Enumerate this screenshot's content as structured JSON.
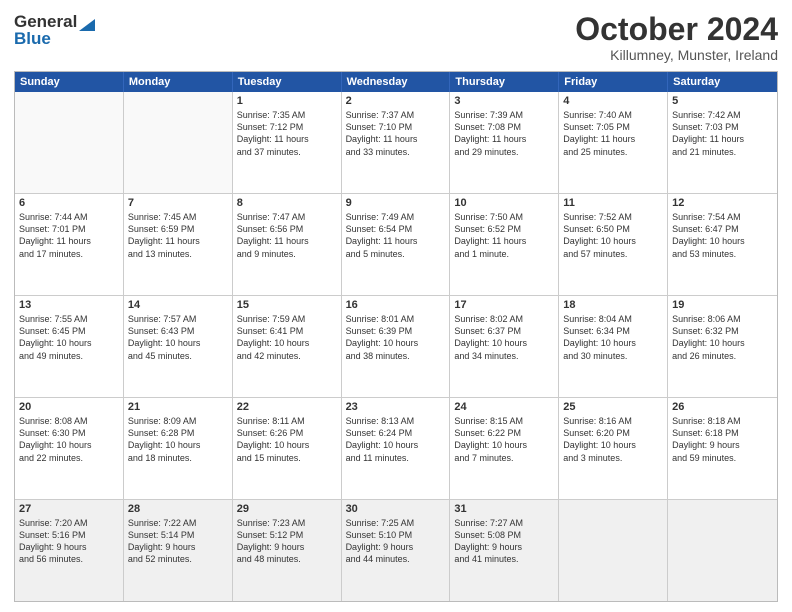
{
  "logo": {
    "line1": "General",
    "line2": "Blue"
  },
  "title": "October 2024",
  "location": "Killumney, Munster, Ireland",
  "days": [
    "Sunday",
    "Monday",
    "Tuesday",
    "Wednesday",
    "Thursday",
    "Friday",
    "Saturday"
  ],
  "weeks": [
    [
      {
        "day": "",
        "text": ""
      },
      {
        "day": "",
        "text": ""
      },
      {
        "day": "1",
        "text": "Sunrise: 7:35 AM\nSunset: 7:12 PM\nDaylight: 11 hours\nand 37 minutes."
      },
      {
        "day": "2",
        "text": "Sunrise: 7:37 AM\nSunset: 7:10 PM\nDaylight: 11 hours\nand 33 minutes."
      },
      {
        "day": "3",
        "text": "Sunrise: 7:39 AM\nSunset: 7:08 PM\nDaylight: 11 hours\nand 29 minutes."
      },
      {
        "day": "4",
        "text": "Sunrise: 7:40 AM\nSunset: 7:05 PM\nDaylight: 11 hours\nand 25 minutes."
      },
      {
        "day": "5",
        "text": "Sunrise: 7:42 AM\nSunset: 7:03 PM\nDaylight: 11 hours\nand 21 minutes."
      }
    ],
    [
      {
        "day": "6",
        "text": "Sunrise: 7:44 AM\nSunset: 7:01 PM\nDaylight: 11 hours\nand 17 minutes."
      },
      {
        "day": "7",
        "text": "Sunrise: 7:45 AM\nSunset: 6:59 PM\nDaylight: 11 hours\nand 13 minutes."
      },
      {
        "day": "8",
        "text": "Sunrise: 7:47 AM\nSunset: 6:56 PM\nDaylight: 11 hours\nand 9 minutes."
      },
      {
        "day": "9",
        "text": "Sunrise: 7:49 AM\nSunset: 6:54 PM\nDaylight: 11 hours\nand 5 minutes."
      },
      {
        "day": "10",
        "text": "Sunrise: 7:50 AM\nSunset: 6:52 PM\nDaylight: 11 hours\nand 1 minute."
      },
      {
        "day": "11",
        "text": "Sunrise: 7:52 AM\nSunset: 6:50 PM\nDaylight: 10 hours\nand 57 minutes."
      },
      {
        "day": "12",
        "text": "Sunrise: 7:54 AM\nSunset: 6:47 PM\nDaylight: 10 hours\nand 53 minutes."
      }
    ],
    [
      {
        "day": "13",
        "text": "Sunrise: 7:55 AM\nSunset: 6:45 PM\nDaylight: 10 hours\nand 49 minutes."
      },
      {
        "day": "14",
        "text": "Sunrise: 7:57 AM\nSunset: 6:43 PM\nDaylight: 10 hours\nand 45 minutes."
      },
      {
        "day": "15",
        "text": "Sunrise: 7:59 AM\nSunset: 6:41 PM\nDaylight: 10 hours\nand 42 minutes."
      },
      {
        "day": "16",
        "text": "Sunrise: 8:01 AM\nSunset: 6:39 PM\nDaylight: 10 hours\nand 38 minutes."
      },
      {
        "day": "17",
        "text": "Sunrise: 8:02 AM\nSunset: 6:37 PM\nDaylight: 10 hours\nand 34 minutes."
      },
      {
        "day": "18",
        "text": "Sunrise: 8:04 AM\nSunset: 6:34 PM\nDaylight: 10 hours\nand 30 minutes."
      },
      {
        "day": "19",
        "text": "Sunrise: 8:06 AM\nSunset: 6:32 PM\nDaylight: 10 hours\nand 26 minutes."
      }
    ],
    [
      {
        "day": "20",
        "text": "Sunrise: 8:08 AM\nSunset: 6:30 PM\nDaylight: 10 hours\nand 22 minutes."
      },
      {
        "day": "21",
        "text": "Sunrise: 8:09 AM\nSunset: 6:28 PM\nDaylight: 10 hours\nand 18 minutes."
      },
      {
        "day": "22",
        "text": "Sunrise: 8:11 AM\nSunset: 6:26 PM\nDaylight: 10 hours\nand 15 minutes."
      },
      {
        "day": "23",
        "text": "Sunrise: 8:13 AM\nSunset: 6:24 PM\nDaylight: 10 hours\nand 11 minutes."
      },
      {
        "day": "24",
        "text": "Sunrise: 8:15 AM\nSunset: 6:22 PM\nDaylight: 10 hours\nand 7 minutes."
      },
      {
        "day": "25",
        "text": "Sunrise: 8:16 AM\nSunset: 6:20 PM\nDaylight: 10 hours\nand 3 minutes."
      },
      {
        "day": "26",
        "text": "Sunrise: 8:18 AM\nSunset: 6:18 PM\nDaylight: 9 hours\nand 59 minutes."
      }
    ],
    [
      {
        "day": "27",
        "text": "Sunrise: 7:20 AM\nSunset: 5:16 PM\nDaylight: 9 hours\nand 56 minutes."
      },
      {
        "day": "28",
        "text": "Sunrise: 7:22 AM\nSunset: 5:14 PM\nDaylight: 9 hours\nand 52 minutes."
      },
      {
        "day": "29",
        "text": "Sunrise: 7:23 AM\nSunset: 5:12 PM\nDaylight: 9 hours\nand 48 minutes."
      },
      {
        "day": "30",
        "text": "Sunrise: 7:25 AM\nSunset: 5:10 PM\nDaylight: 9 hours\nand 44 minutes."
      },
      {
        "day": "31",
        "text": "Sunrise: 7:27 AM\nSunset: 5:08 PM\nDaylight: 9 hours\nand 41 minutes."
      },
      {
        "day": "",
        "text": ""
      },
      {
        "day": "",
        "text": ""
      }
    ]
  ]
}
